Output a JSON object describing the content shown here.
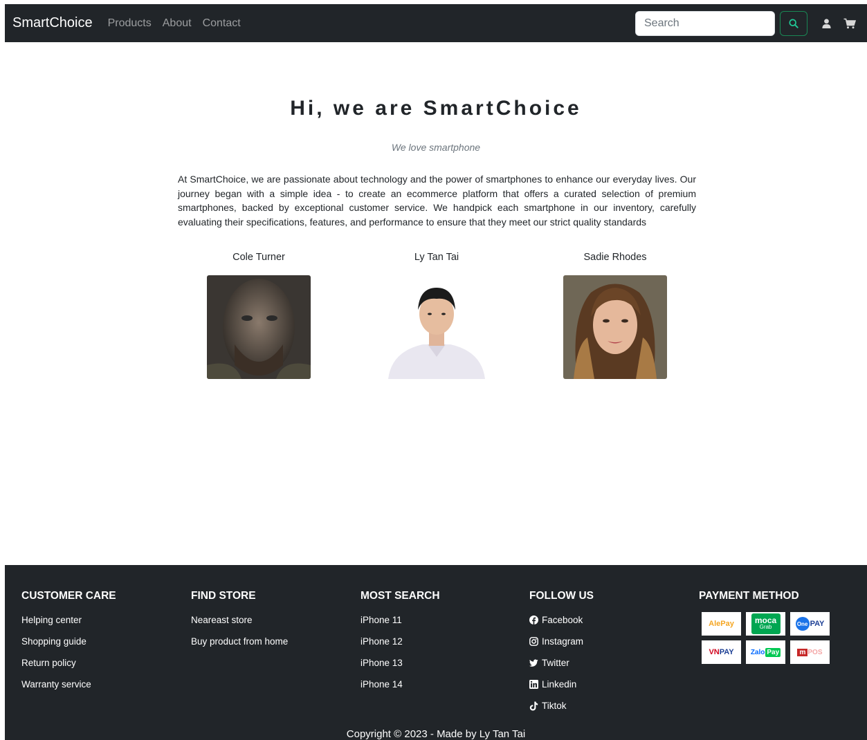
{
  "navbar": {
    "brand": "SmartChoice",
    "links": [
      "Products",
      "About",
      "Contact"
    ],
    "search_placeholder": "Search",
    "icons": [
      "search-icon",
      "user-icon",
      "cart-icon"
    ],
    "accent": "#198754"
  },
  "main": {
    "title": "Hi, we are SmartChoice",
    "tagline": "We love smartphone",
    "intro": "At SmartChoice, we are passionate about technology and the power of smartphones to enhance our everyday lives. Our journey began with a simple idea - to create an ecommerce platform that offers a curated selection of premium smartphones, backed by exceptional customer service. We handpick each smartphone in our inventory, carefully evaluating their specifications, features, and performance to ensure that they meet our strict quality standards",
    "team": [
      {
        "name": "Cole Turner"
      },
      {
        "name": "Ly Tan Tai"
      },
      {
        "name": "Sadie Rhodes"
      }
    ]
  },
  "footer": {
    "customer_care": {
      "heading": "CUSTOMER CARE",
      "items": [
        "Helping center",
        "Shopping guide",
        "Return policy",
        "Warranty service"
      ]
    },
    "find_store": {
      "heading": "FIND STORE",
      "items": [
        "Neareast store",
        "Buy product from home"
      ]
    },
    "most_search": {
      "heading": "MOST SEARCH",
      "items": [
        "iPhone 11",
        "iPhone 12",
        "iPhone 13",
        "iPhone 14"
      ]
    },
    "follow_us": {
      "heading": "FOLLOW US",
      "items": [
        {
          "label": "Facebook",
          "icon": "facebook-icon"
        },
        {
          "label": "Instagram",
          "icon": "instagram-icon"
        },
        {
          "label": "Twitter",
          "icon": "twitter-icon"
        },
        {
          "label": "Linkedin",
          "icon": "linkedin-icon"
        },
        {
          "label": "Tiktok",
          "icon": "tiktok-icon"
        }
      ]
    },
    "payment": {
      "heading": "PAYMENT METHOD",
      "logos": [
        "AlePay",
        "moca",
        "Grab",
        "One",
        "PAY",
        "VNPAY",
        "Zalo",
        "Pay",
        "m",
        "POS"
      ]
    },
    "copyright": "Copyright © 2023 - Made by Ly Tan Tai",
    "bg": "#212529"
  }
}
